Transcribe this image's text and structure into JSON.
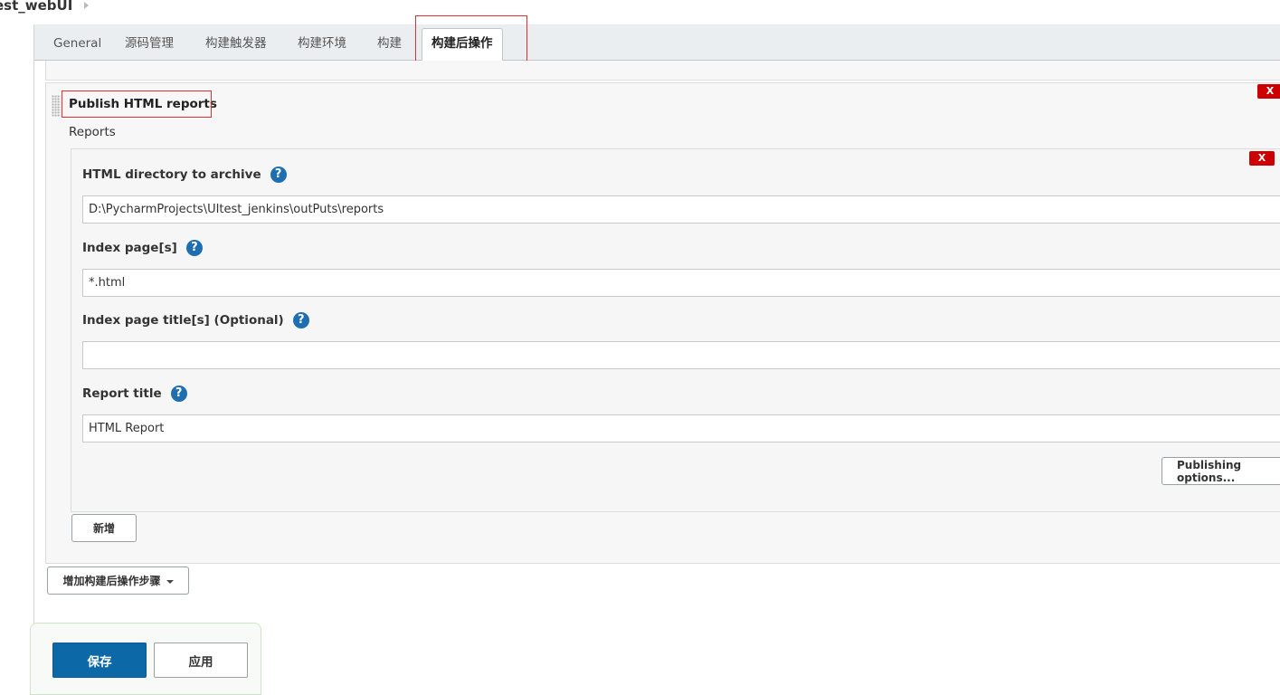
{
  "breadcrumb": {
    "project": "est_webUI"
  },
  "tabs": [
    {
      "label": "General"
    },
    {
      "label": "源码管理"
    },
    {
      "label": "构建触发器"
    },
    {
      "label": "构建环境"
    },
    {
      "label": "构建"
    },
    {
      "label": "构建后操作",
      "active": true
    }
  ],
  "publish_section": {
    "title": "Publish HTML reports",
    "delete_label": "X",
    "reports_label": "Reports",
    "report": {
      "delete_label": "X",
      "help_glyph": "?",
      "html_dir": {
        "label": "HTML directory to archive",
        "value": "D:\\PycharmProjects\\UItest_jenkins\\outPuts\\reports"
      },
      "index_pages": {
        "label": "Index page[s]",
        "value": "*.html"
      },
      "index_titles": {
        "label": "Index page title[s] (Optional)",
        "value": ""
      },
      "report_title": {
        "label": "Report title",
        "value": "HTML Report"
      },
      "publishing_options_label": "Publishing options..."
    },
    "add_label": "新增"
  },
  "add_post_build_step_label": "增加构建后操作步骤",
  "actions": {
    "save_label": "保存",
    "apply_label": "应用"
  },
  "colors": {
    "primary": "#0d68a8",
    "delete": "#cc0000",
    "help": "#1f6fb0",
    "highlight": "#e03030"
  }
}
